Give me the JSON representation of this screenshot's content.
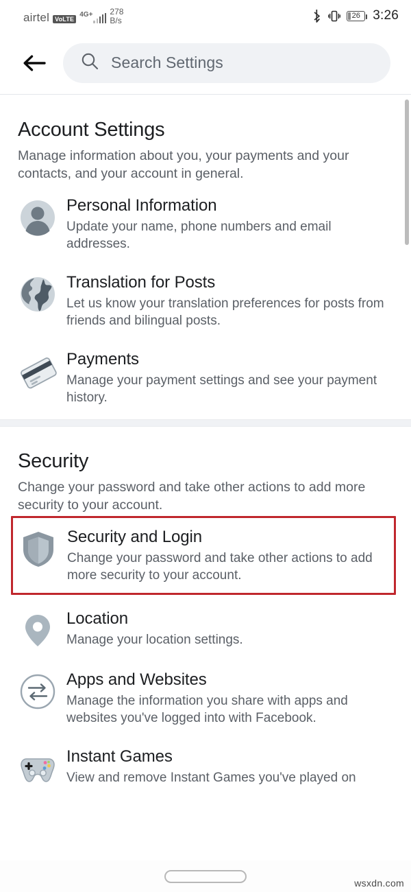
{
  "statusbar": {
    "carrier": "airtel",
    "volte_badge": "VoLTE",
    "network_gen": "4G+",
    "data_speed_value": "278",
    "data_speed_unit": "B/s",
    "bluetooth_icon": "bluetooth-icon",
    "vibrate_icon": "vibrate-icon",
    "battery_percent": "26",
    "clock": "3:26"
  },
  "header": {
    "back_icon": "back-arrow-icon",
    "search_icon": "search-icon",
    "search_placeholder": "Search Settings",
    "search_value": ""
  },
  "sections": [
    {
      "id": "account-settings",
      "title": "Account Settings",
      "description": "Manage information about you, your payments and your contacts, and your account in general.",
      "items": [
        {
          "icon": "person-avatar-icon",
          "title": "Personal Information",
          "subtitle": "Update your name, phone numbers and email addresses.",
          "highlighted": false
        },
        {
          "icon": "globe-icon",
          "title": "Translation for Posts",
          "subtitle": "Let us know your translation preferences for posts from friends and bilingual posts.",
          "highlighted": false
        },
        {
          "icon": "credit-card-icon",
          "title": "Payments",
          "subtitle": "Manage your payment settings and see your payment history.",
          "highlighted": false
        }
      ]
    },
    {
      "id": "security",
      "title": "Security",
      "description": "Change your password and take other actions to add more security to your account.",
      "items": [
        {
          "icon": "shield-icon",
          "title": "Security and Login",
          "subtitle": "Change your password and take other actions to add more security to your account.",
          "highlighted": true
        },
        {
          "icon": "location-pin-icon",
          "title": "Location",
          "subtitle": "Manage your location settings.",
          "highlighted": false
        },
        {
          "icon": "two-way-arrows-icon",
          "title": "Apps and Websites",
          "subtitle": "Manage the information you share with apps and websites you've logged into with Facebook.",
          "highlighted": false
        },
        {
          "icon": "gamepad-icon",
          "title": "Instant Games",
          "subtitle": "View and remove Instant Games you've played on",
          "highlighted": false
        }
      ]
    }
  ],
  "colors": {
    "highlight_border": "#c0272d",
    "search_background": "#f0f2f5",
    "text_primary": "#1c1e21",
    "text_secondary": "#5a5f66",
    "scrollbar": "#bcbcbc"
  },
  "bottom": {
    "home_indicator": "home-indicator-pill",
    "watermark": "wsxdn.com"
  }
}
